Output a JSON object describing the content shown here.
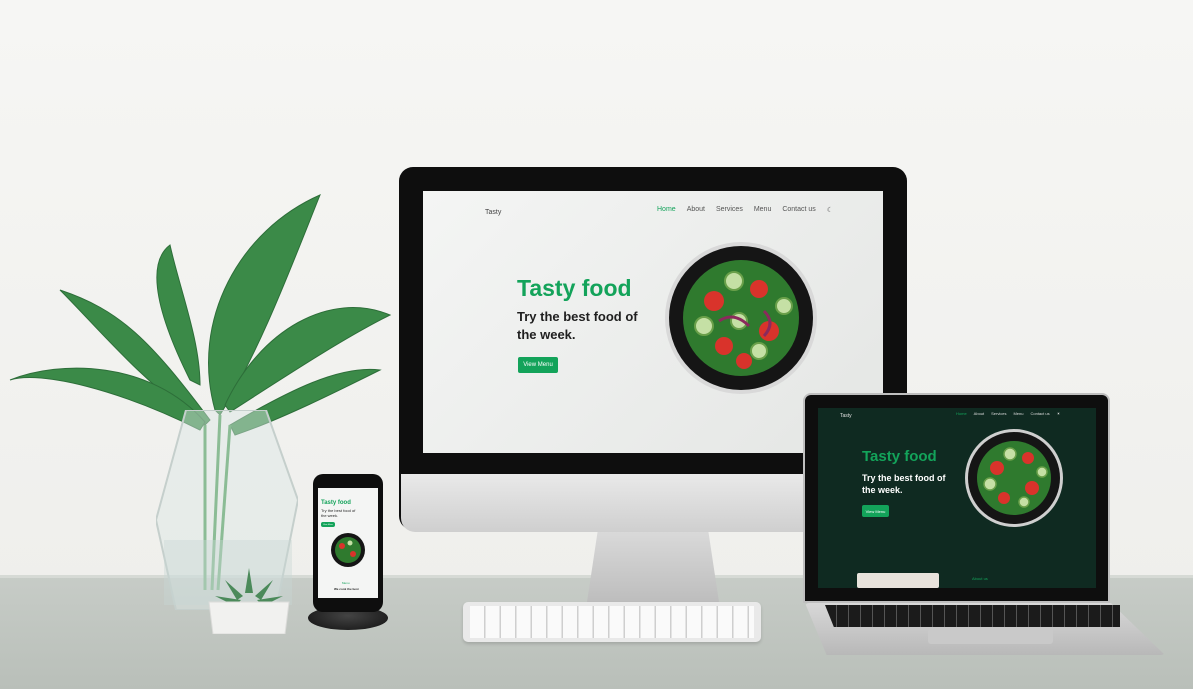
{
  "site": {
    "logo": "Tasty",
    "nav": [
      {
        "label": "Home",
        "active": true
      },
      {
        "label": "About",
        "active": false
      },
      {
        "label": "Services",
        "active": false
      },
      {
        "label": "Menu",
        "active": false
      },
      {
        "label": "Contact us",
        "active": false
      }
    ],
    "hero_title": "Tasty food",
    "hero_subtitle": "Try the best food of the week.",
    "cta_label": "View Menu"
  },
  "mobile": {
    "section_label": "Menu",
    "section_text": "We cook the best"
  },
  "laptop": {
    "section_label": "About us"
  },
  "colors": {
    "accent": "#13a35a",
    "dark_bg": "#0f2a21",
    "light_bg": "#f4f5f4"
  },
  "icons": [
    "theme-toggle-icon",
    "salad-bowl-image"
  ]
}
